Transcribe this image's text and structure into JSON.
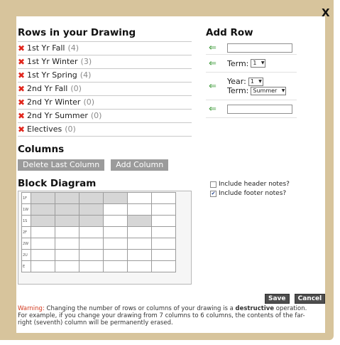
{
  "close_label": "X",
  "rows_section": {
    "title": "Rows in your Drawing",
    "rows": [
      {
        "label": "1st Yr Fall",
        "count": "(4)"
      },
      {
        "label": "1st Yr Winter",
        "count": "(3)"
      },
      {
        "label": "1st Yr Spring",
        "count": "(4)"
      },
      {
        "label": "2nd Yr Fall",
        "count": "(0)"
      },
      {
        "label": "2nd Yr Winter",
        "count": "(0)"
      },
      {
        "label": "2nd Yr Summer",
        "count": "(0)"
      },
      {
        "label": "Electives",
        "count": "(0)"
      }
    ]
  },
  "add_row": {
    "title": "Add Row",
    "term_label": "Term:",
    "term_value": "1",
    "year_label": "Year:",
    "year_value": "1",
    "term2_label": "Term:",
    "term2_value": "Summer"
  },
  "columns_section": {
    "title": "Columns",
    "delete_label": "Delete Last Column",
    "add_label": "Add Column"
  },
  "block_diagram": {
    "title": "Block Diagram",
    "row_labels": [
      "1F",
      "1W",
      "1S",
      "2F",
      "2W",
      "2U",
      "E"
    ],
    "filled": [
      [
        1,
        1,
        1,
        1,
        0,
        0
      ],
      [
        1,
        1,
        1,
        0,
        0,
        0
      ],
      [
        1,
        1,
        1,
        0,
        1,
        0
      ],
      [
        0,
        0,
        0,
        0,
        0,
        0
      ],
      [
        0,
        0,
        0,
        0,
        0,
        0
      ],
      [
        0,
        0,
        0,
        0,
        0,
        0
      ],
      [
        0,
        0,
        0,
        0,
        0,
        0
      ]
    ]
  },
  "notes": {
    "header_label": "Include header notes?",
    "header_checked": false,
    "footer_label": "Include footer notes?",
    "footer_checked": true
  },
  "actions": {
    "save_label": "Save",
    "cancel_label": "Cancel"
  },
  "warning": {
    "lead": "Warning:",
    "text_before": " Changing the number of rows or columns of your drawing is a ",
    "emphasis": "destructive",
    "text_after": " operation. For example, if you change your drawing from 7 columns to 6 columns, the contents of the far-right (seventh) column will be permanently erased."
  },
  "colors": {
    "frame": "#d7c49c",
    "delete_x": "#e1261c",
    "arrow": "#3f9b3a",
    "warning": "#d2391e"
  }
}
